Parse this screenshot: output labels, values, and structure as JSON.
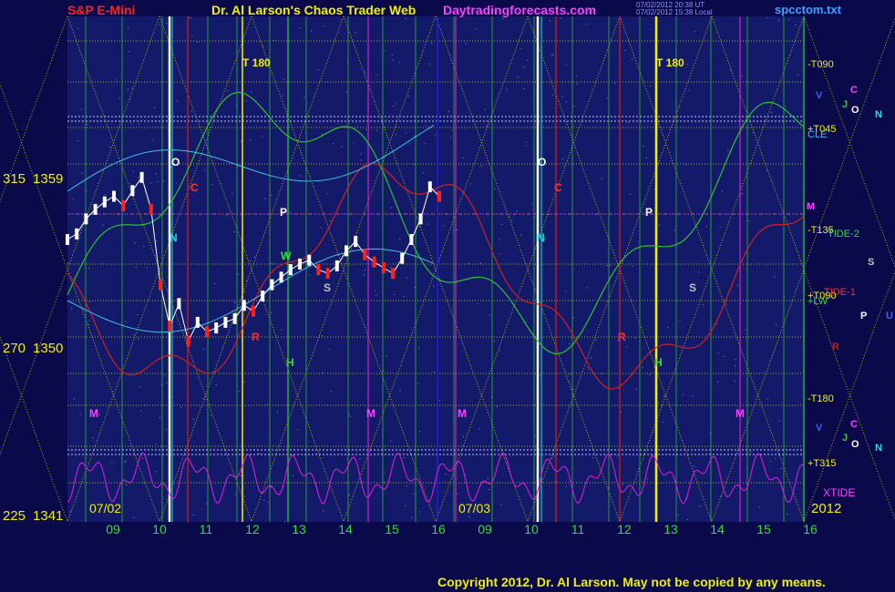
{
  "header": {
    "symbol": "S&P E-Mini",
    "title": "Dr. Al Larson's Chaos Trader Web",
    "site": "Daytradingforecasts.com",
    "stamp1": "07/02/2012 20:38 UT",
    "stamp2": "07/02/2012 15:38 Local",
    "file": "spcctom.txt"
  },
  "footer": {
    "copyright": "Copyright 2012, Dr. Al Larson. May not be copied by any means."
  },
  "colors": {
    "background": "#0a0a4a",
    "plot_bg": "#141a6a",
    "grid_yellow": "#d8d800",
    "grid_green": "#2fb82f",
    "accent_magenta": "#e020e0"
  },
  "chart_data": {
    "type": "line",
    "y_axis_labels": [
      {
        "deg": "315",
        "price": "1359",
        "value": 1359
      },
      {
        "deg": "270",
        "price": "1350",
        "value": 1350
      },
      {
        "deg": "225",
        "price": "1341",
        "value": 1341
      }
    ],
    "ylim": [
      1341,
      1362.5
    ],
    "x_axis_hours": [
      "09",
      "10",
      "11",
      "12",
      "13",
      "14",
      "15",
      "16",
      "09",
      "10",
      "11",
      "12",
      "13",
      "14",
      "15",
      "16"
    ],
    "date_labels": [
      "07/02",
      "07/03",
      "2012"
    ],
    "right_labels": [
      "-T090",
      "+T045",
      "CLE",
      "-T135",
      "TIDE-2",
      "+T090",
      "TIDE-1",
      "+LW",
      "-T180",
      "+T315",
      "XTIDE"
    ],
    "planet_glyphs": [
      "V",
      "C",
      "J",
      "O",
      "N",
      "M",
      "S",
      "P",
      "U",
      "R"
    ],
    "chart_glyphs": [
      "T 180",
      "T 180",
      "O",
      "C",
      "N",
      "P",
      "S",
      "H",
      "M",
      "R",
      "W"
    ],
    "price_series": {
      "name": "",
      "x": [
        8.0,
        8.2,
        8.4,
        8.6,
        8.8,
        9.0,
        9.2,
        9.4,
        9.6,
        9.8,
        10.0,
        10.2,
        10.4,
        10.6,
        10.8,
        11.0,
        11.2,
        11.4,
        11.6,
        11.8,
        12.0,
        12.2,
        12.4,
        12.6,
        12.8,
        13.0,
        13.2,
        13.4,
        13.6,
        13.8,
        14.0,
        14.2,
        14.4,
        14.6,
        14.8,
        15.0,
        15.2,
        15.4,
        15.6,
        15.8,
        16.0
      ],
      "y": [
        1356.0,
        1356.3,
        1357.1,
        1357.6,
        1358.0,
        1358.3,
        1357.8,
        1358.6,
        1359.3,
        1357.6,
        1353.6,
        1351.4,
        1352.6,
        1350.6,
        1351.6,
        1351.1,
        1351.3,
        1351.6,
        1351.8,
        1352.5,
        1352.2,
        1353.0,
        1353.6,
        1354.0,
        1354.4,
        1354.7,
        1354.9,
        1354.4,
        1354.2,
        1354.6,
        1355.4,
        1355.9,
        1355.2,
        1354.8,
        1354.5,
        1354.2,
        1355.0,
        1356.0,
        1357.1,
        1358.8,
        1358.3
      ]
    }
  }
}
